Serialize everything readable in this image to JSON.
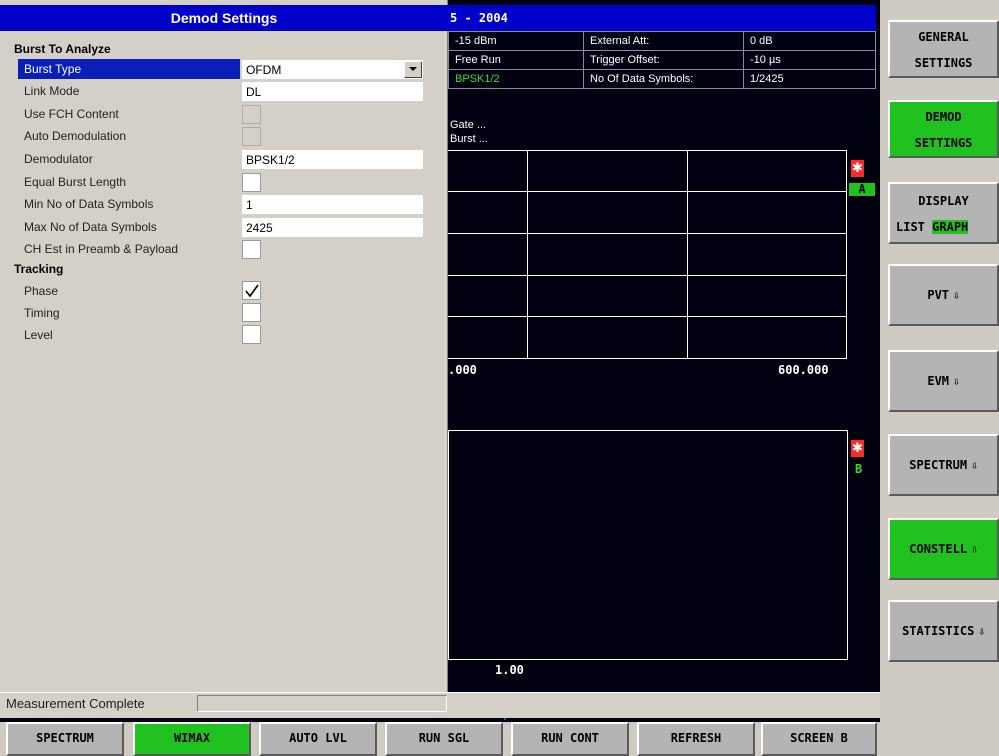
{
  "measurement": {
    "title_fragment": "5 - 2004",
    "info_rows": [
      [
        "-15 dBm",
        "External Att:",
        "0 dB"
      ],
      [
        "Free Run",
        "Trigger Offset:",
        "-10 µs"
      ],
      [
        "BPSK1/2",
        "No Of Data Symbols:",
        "1/2425"
      ]
    ],
    "gate_label": "Gate   ...",
    "burst_label": "Burst   ...",
    "screen_a": {
      "marker_symbol": "✱",
      "trace_tag": "A",
      "x_start": ".000",
      "x_end": "600.000"
    },
    "screen_b": {
      "marker_symbol": "✱",
      "trace_tag": "B",
      "x_start": "1.00"
    }
  },
  "dialog": {
    "title": "Demod Settings",
    "burst_section": "Burst To Analyze",
    "tracking_section": "Tracking",
    "rows": {
      "burst_type": {
        "label": "Burst Type",
        "value": "OFDM"
      },
      "link_mode": {
        "label": "Link Mode",
        "value": "DL"
      },
      "use_fch": {
        "label": "Use FCH Content",
        "checked": false
      },
      "auto_demod": {
        "label": "Auto Demodulation",
        "checked": false
      },
      "demodulator": {
        "label": "Demodulator",
        "value": "BPSK1/2"
      },
      "equal_burst": {
        "label": "Equal Burst Length",
        "checked": false
      },
      "min_symbols": {
        "label": "Min No of Data Symbols",
        "value": "1"
      },
      "max_symbols": {
        "label": "Max No of Data Symbols",
        "value": "2425"
      },
      "ch_est": {
        "label": "CH Est in Preamb & Payload",
        "checked": false
      },
      "phase": {
        "label": "Phase",
        "checked": true
      },
      "timing": {
        "label": "Timing",
        "checked": false
      },
      "level": {
        "label": "Level",
        "checked": false
      }
    }
  },
  "status": {
    "text": "Measurement Complete"
  },
  "softkeys": {
    "general_1": "GENERAL",
    "general_2": "SETTINGS",
    "demod_1": "DEMOD",
    "demod_2": "SETTINGS",
    "display_1": "DISPLAY",
    "display_list": "LIST",
    "display_graph": "GRAPH",
    "pvt": "PVT",
    "evm": "EVM",
    "spectrum": "SPECTRUM",
    "constell": "CONSTELL",
    "statistics": "STATISTICS",
    "arrow": "⇩"
  },
  "hotkeys": [
    "SPECTRUM",
    "WIMAX",
    "AUTO LVL",
    "RUN SGL",
    "RUN CONT",
    "REFRESH",
    "SCREEN B"
  ],
  "colors": {
    "active_green": "#1fc21f",
    "title_blue": "#0000c8",
    "trace_green": "#2ee02e",
    "marker_red": "#ff2a2a"
  }
}
